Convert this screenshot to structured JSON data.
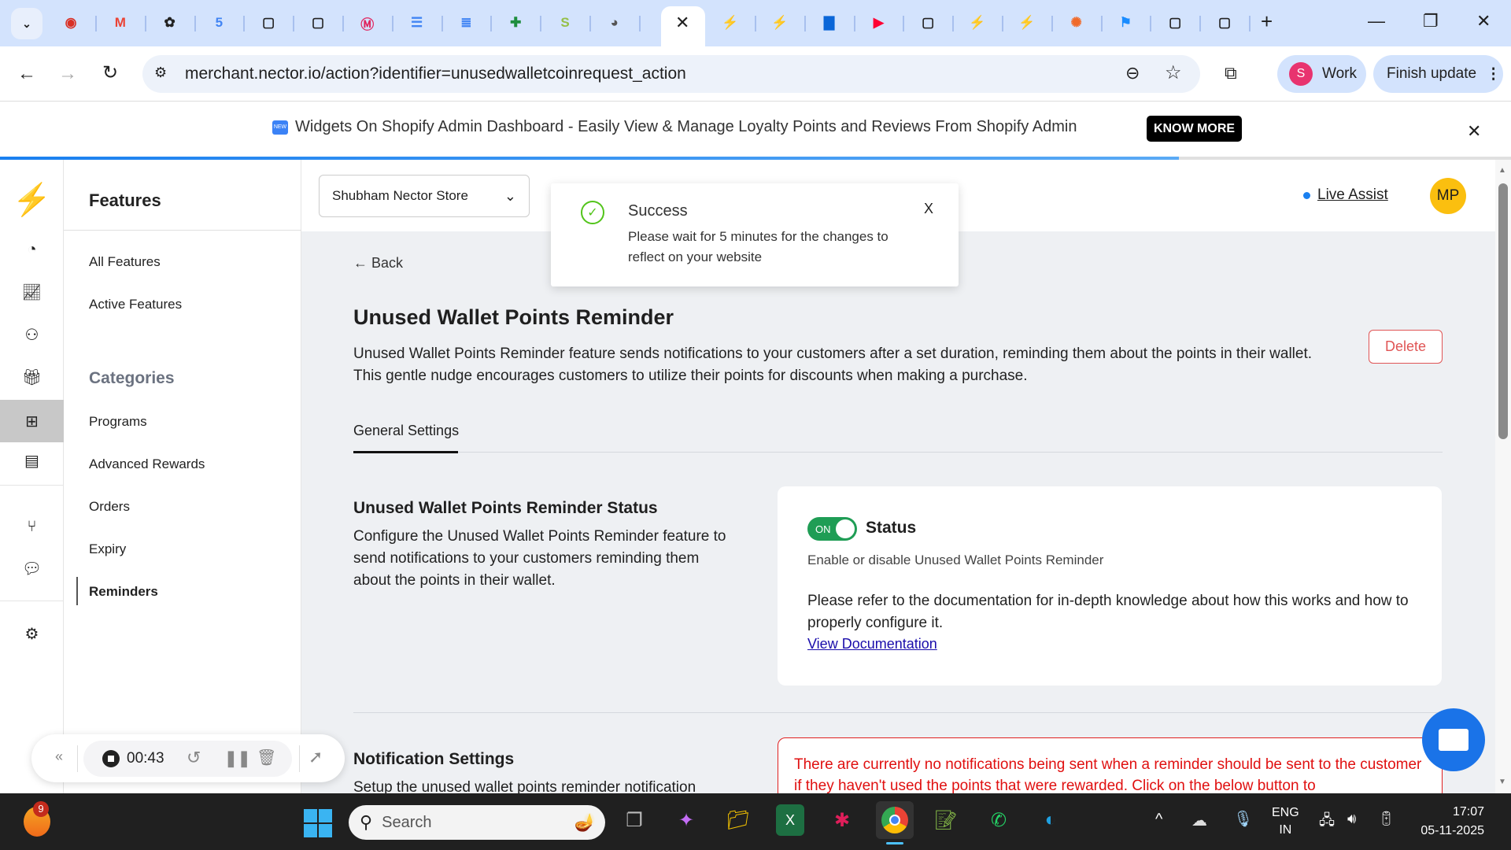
{
  "browser": {
    "tabs": [
      {
        "icon": "record-icon",
        "color": "#d93025"
      },
      {
        "icon": "gmail-icon",
        "color": "#ea4335"
      },
      {
        "icon": "openai-icon",
        "color": "#222"
      },
      {
        "icon": "calendar-icon",
        "color": "#4285f4"
      },
      {
        "icon": "square-icon",
        "color": "#222"
      },
      {
        "icon": "square-icon",
        "color": "#222"
      },
      {
        "icon": "m-logo-icon",
        "color": "#e0245e"
      },
      {
        "icon": "list-icon",
        "color": "#4285f4"
      },
      {
        "icon": "docs-icon",
        "color": "#4285f4"
      },
      {
        "icon": "sheets-plus-icon",
        "color": "#1e8e3e"
      },
      {
        "icon": "shopify-icon",
        "color": "#95bf47"
      },
      {
        "icon": "globe-icon",
        "color": "#555"
      }
    ],
    "tabs_right": [
      {
        "icon": "bolt-icon",
        "color": "#f5c400"
      },
      {
        "icon": "bolt-icon",
        "color": "#f5c400"
      },
      {
        "icon": "chat-tab-icon",
        "color": "#0a66d8"
      },
      {
        "icon": "youtube-icon",
        "color": "#ff0033"
      },
      {
        "icon": "square-icon",
        "color": "#222"
      },
      {
        "icon": "bolt-icon",
        "color": "#f5c400"
      },
      {
        "icon": "bolt-icon",
        "color": "#f5c400"
      },
      {
        "icon": "orange-logo-icon",
        "color": "#f06a2a"
      },
      {
        "icon": "flag-icon",
        "color": "#1a8cff"
      },
      {
        "icon": "square-icon",
        "color": "#222"
      },
      {
        "icon": "square-icon",
        "color": "#222"
      }
    ],
    "url": "merchant.nector.io/action?identifier=unusedwalletcoinrequest_action",
    "profile_initial": "S",
    "profile_label": "Work",
    "update_label": "Finish update"
  },
  "banner": {
    "text": "Widgets On Shopify Admin Dashboard - Easily View & Manage Loyalty Points and Reviews From Shopify Admin",
    "button": "KNOW MORE",
    "progress": 0.78
  },
  "sidebar": {
    "title": "Features",
    "items": [
      "All Features",
      "Active Features"
    ],
    "categories_title": "Categories",
    "categories": [
      "Programs",
      "Advanced Rewards",
      "Orders",
      "Expiry",
      "Reminders"
    ],
    "active": "Reminders"
  },
  "header": {
    "store": "Shubham Nector Store",
    "live_assist": "Live Assist",
    "avatar": "MP"
  },
  "toast": {
    "title": "Success",
    "message": "Please wait for 5 minutes for the changes to reflect on your website",
    "close": "X"
  },
  "page": {
    "back": "Back",
    "title": "Unused Wallet Points Reminder",
    "description": "Unused Wallet Points Reminder feature sends notifications to your customers after a set duration, reminding them about the points in their wallet. This gentle nudge encourages customers to utilize their points for discounts when making a purchase.",
    "delete": "Delete",
    "tab": "General Settings",
    "status_section": {
      "heading": "Unused Wallet Points Reminder Status",
      "desc": "Configure the Unused Wallet Points Reminder feature to send notifications to your customers reminding them about the points in their wallet."
    },
    "status_card": {
      "toggle": "ON",
      "toggle_on": true,
      "label": "Status",
      "sub": "Enable or disable Unused Wallet Points Reminder",
      "doc_text": "Please refer to the documentation for in-depth knowledge about how this works and how to properly configure it.",
      "doc_link": "View Documentation"
    },
    "notification_section": {
      "heading": "Notification Settings",
      "desc": "Setup the unused wallet points reminder notification"
    },
    "warning": "There are currently no notifications being sent when a reminder should be sent to the customer if they haven't used the points that were rewarded. Click on the below button to"
  },
  "recorder": {
    "time": "00:43"
  },
  "taskbar": {
    "badge": "9",
    "search": "Search",
    "lang1": "ENG",
    "lang2": "IN",
    "time": "17:07",
    "date": "05-11-2025"
  }
}
